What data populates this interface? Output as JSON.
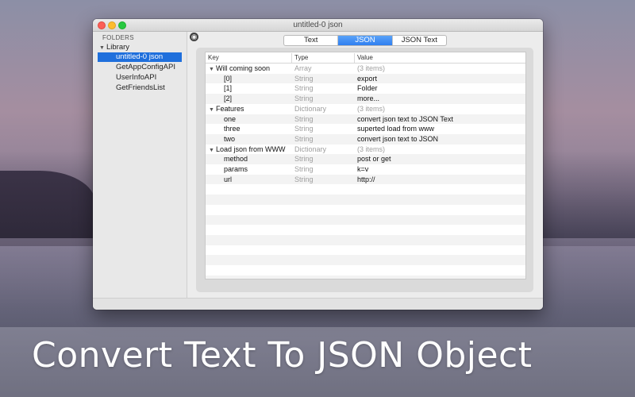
{
  "window": {
    "title": "untitled-0 json"
  },
  "sidebar": {
    "header": "FOLDERS",
    "library": "Library",
    "items": [
      {
        "label": "untitled-0 json",
        "selected": true
      },
      {
        "label": "GetAppConfigAPI"
      },
      {
        "label": "UserInfoAPI"
      },
      {
        "label": "GetFriendsList"
      }
    ]
  },
  "tabs": [
    {
      "label": "Text"
    },
    {
      "label": "JSON",
      "active": true
    },
    {
      "label": "JSON Text"
    }
  ],
  "table": {
    "columns": {
      "key": "Key",
      "type": "Type",
      "value": "Value"
    },
    "rows": [
      {
        "key": "Will coming soon",
        "type": "Array",
        "value": "(3 items)",
        "level": 0,
        "expandable": true
      },
      {
        "key": "[0]",
        "type": "String",
        "value": "export",
        "level": 1
      },
      {
        "key": "[1]",
        "type": "String",
        "value": "Folder",
        "level": 1
      },
      {
        "key": "[2]",
        "type": "String",
        "value": "more...",
        "level": 1
      },
      {
        "key": "Features",
        "type": "Dictionary",
        "value": "(3 items)",
        "level": 0,
        "expandable": true
      },
      {
        "key": "one",
        "type": "String",
        "value": "convert json text to JSON Text",
        "level": 1
      },
      {
        "key": "three",
        "type": "String",
        "value": "superted load from www",
        "level": 1
      },
      {
        "key": "two",
        "type": "String",
        "value": "convert json text to JSON",
        "level": 1
      },
      {
        "key": "Load json from WWW",
        "type": "Dictionary",
        "value": "(3 items)",
        "level": 0,
        "expandable": true
      },
      {
        "key": "method",
        "type": "String",
        "value": "post or get",
        "level": 1
      },
      {
        "key": "params",
        "type": "String",
        "value": "k=v",
        "level": 1
      },
      {
        "key": "url",
        "type": "String",
        "value": "http://",
        "level": 1
      }
    ]
  },
  "caption": "Convert Text To JSON Object",
  "colors": {
    "accent": "#1f6fdc",
    "tab_active": "#3a86f3",
    "close": "#fc5f57",
    "minimize": "#fdbc2e",
    "zoom": "#28c840"
  }
}
